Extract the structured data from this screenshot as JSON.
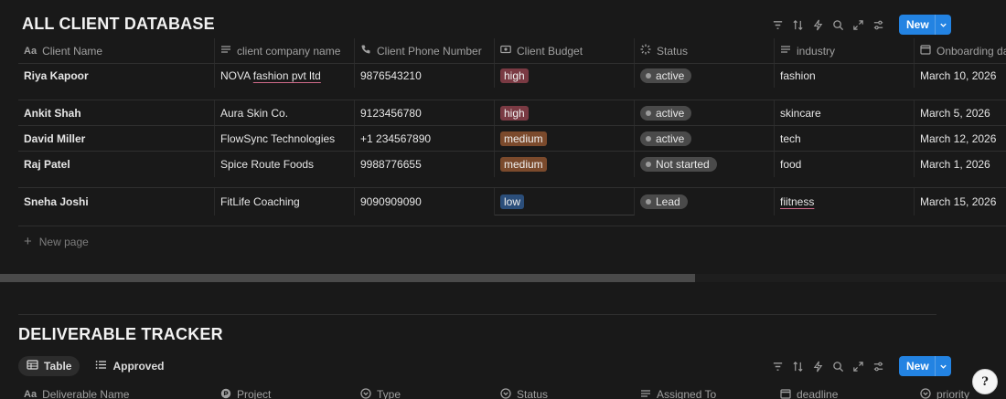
{
  "client_db": {
    "title": "ALL CLIENT DATABASE",
    "new_label": "New",
    "columns": [
      {
        "label": "Client Name",
        "icon": "aa-title-icon"
      },
      {
        "label": "client company name",
        "icon": "text-lines-icon"
      },
      {
        "label": "Client Phone Number",
        "icon": "phone-icon"
      },
      {
        "label": "Client Budget",
        "icon": "money-icon"
      },
      {
        "label": "Status",
        "icon": "status-spinner-icon"
      },
      {
        "label": "industry",
        "icon": "text-lines-icon"
      },
      {
        "label": "Onboarding dat",
        "icon": "calendar-icon"
      }
    ],
    "rows": [
      {
        "name": "Riya Kapoor",
        "company_pre": "NOVA ",
        "company_link": "fashion pvt ltd",
        "phone": "9876543210",
        "budget": "high",
        "status": "active",
        "industry": "fashion",
        "date": "March 10, 2026"
      },
      {
        "name": "Ankit Shah",
        "company": "Aura Skin Co.",
        "phone": "9123456780",
        "budget": "high",
        "status": "active",
        "industry": "skincare",
        "date": "March 5, 2026"
      },
      {
        "name": "David Miller",
        "company": "FlowSync Technologies",
        "phone": "+1 234567890",
        "budget": "medium",
        "status": "active",
        "industry": "tech",
        "date": "March 12, 2026"
      },
      {
        "name": "Raj Patel",
        "company": "Spice Route Foods",
        "phone": "9988776655",
        "budget": "medium",
        "status": "Not started",
        "industry": "food",
        "date": "March 1, 2026"
      },
      {
        "name": "Sneha Joshi",
        "company": "FitLife Coaching",
        "phone": "9090909090",
        "budget": "low",
        "status": "Lead",
        "industry": "fiitness",
        "date": "March 15, 2026"
      }
    ],
    "new_page_label": "New page",
    "colors": {
      "high": "#7a3a43",
      "medium": "#7b4a2c",
      "low": "#2b4e7a",
      "accent": "#2383e2"
    }
  },
  "deliverable_tracker": {
    "title": "DELIVERABLE TRACKER",
    "new_label": "New",
    "views": [
      {
        "label": "Table",
        "icon": "table-icon",
        "active": true
      },
      {
        "label": "Approved",
        "icon": "list-icon",
        "active": false
      }
    ],
    "columns": [
      {
        "label": "Deliverable Name",
        "icon": "aa-title-icon"
      },
      {
        "label": "Project",
        "icon": "relation-icon"
      },
      {
        "label": "Type",
        "icon": "select-icon"
      },
      {
        "label": "Status",
        "icon": "select-icon"
      },
      {
        "label": "Assigned To",
        "icon": "text-lines-icon"
      },
      {
        "label": "deadline",
        "icon": "calendar-icon"
      },
      {
        "label": "priority",
        "icon": "select-icon"
      }
    ]
  },
  "help_button": {
    "glyph": "?"
  }
}
